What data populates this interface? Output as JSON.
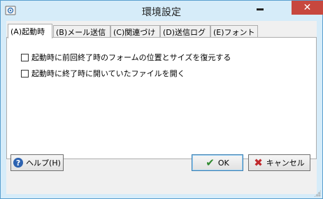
{
  "window": {
    "title": "環境設定",
    "close_glyph": "✕"
  },
  "tabs": [
    {
      "label": "(A)起動時",
      "active": true
    },
    {
      "label": "(B)メール送信",
      "active": false
    },
    {
      "label": "(C)関連づけ",
      "active": false
    },
    {
      "label": "(D)送信ログ",
      "active": false
    },
    {
      "label": "(E)フォント",
      "active": false
    }
  ],
  "options": [
    {
      "label": "起動時に前回終了時のフォームの位置とサイズを復元する",
      "checked": false
    },
    {
      "label": "起動時に終了時に開いていたファイルを開く",
      "checked": false
    }
  ],
  "buttons": {
    "help": {
      "label": "ヘルプ(H)",
      "icon": "help-icon"
    },
    "ok": {
      "label": "OK",
      "icon": "checkmark-icon"
    },
    "cancel": {
      "label": "キャンセル",
      "icon": "cross-icon"
    }
  },
  "colors": {
    "frame": "#d6ecf9",
    "close": "#c7473e",
    "ok_check": "#2f8a2f",
    "cancel_x": "#c0282c"
  }
}
